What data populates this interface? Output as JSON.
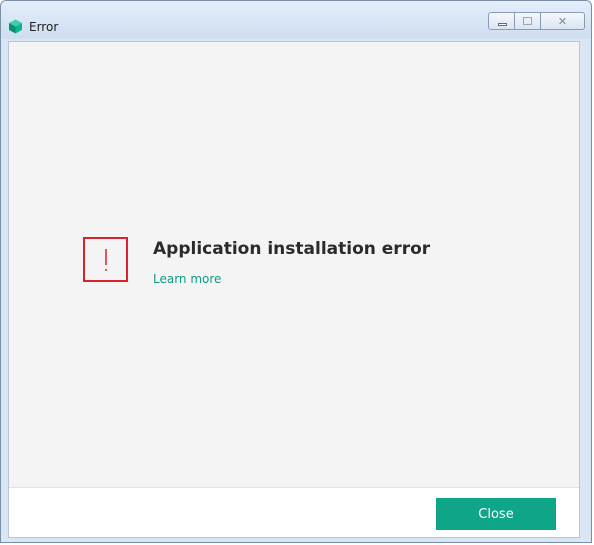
{
  "window": {
    "title": "Error",
    "icon": "kaspersky-cube-icon",
    "caption_buttons": [
      "minimize-icon",
      "maximize-icon",
      "close-icon"
    ]
  },
  "content": {
    "icon": "exclamation-icon",
    "message": "Application installation error",
    "learn_more": "Learn more"
  },
  "footer": {
    "close_label": "Close"
  },
  "colors": {
    "accent": "#0ea588",
    "link": "#0f9a82",
    "error": "#d9222a",
    "background": "#f4f4f4"
  }
}
